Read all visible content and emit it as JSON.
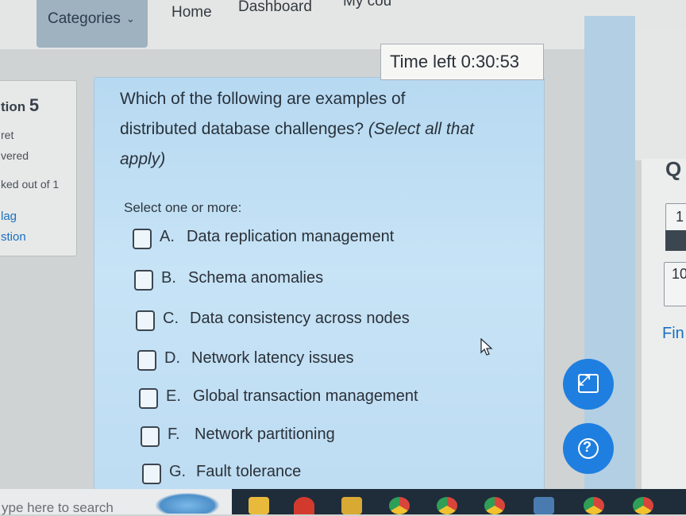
{
  "nav": {
    "categories_label": "Categories",
    "categories_chevron": "⌄",
    "home": "Home",
    "dashboard": "Dashboard",
    "my_courses": "My cou"
  },
  "timer": {
    "label": "Time left 0:30:53"
  },
  "question_info": {
    "number_prefix": "tion",
    "number": "5",
    "status_line1": "ret",
    "status_line2": "vered",
    "marked": "ked out of 1",
    "flag_line1": "lag",
    "flag_line2": "stion"
  },
  "question": {
    "line1": "Which of the following are examples of",
    "line2_plain": "distributed database challenges? ",
    "line2_italic": "(Select all that",
    "line3_italic": "apply)",
    "hint": "Select one or more:"
  },
  "options": [
    {
      "letter": "A.",
      "text": "Data replication management"
    },
    {
      "letter": "B.",
      "text": "Schema anomalies"
    },
    {
      "letter": "C.",
      "text": "Data consistency across nodes"
    },
    {
      "letter": "D.",
      "text": "Network latency issues"
    },
    {
      "letter": "E.",
      "text": "Global transaction management"
    },
    {
      "letter": "F.",
      "text": "Network partitioning"
    },
    {
      "letter": "G.",
      "text": "Fault tolerance"
    }
  ],
  "quiz_nav": {
    "title": "Q",
    "box1": "1",
    "box2": "10",
    "finish": "Fin"
  },
  "taskbar": {
    "search_placeholder": "ype here to search"
  },
  "icons": {
    "expand": "expand-icon",
    "help": "help-icon",
    "cursor": "mouse-cursor-icon"
  },
  "colors": {
    "fab_blue": "#1f7fe0",
    "card_blue": "#bfddf3",
    "link_blue": "#1a6fc0"
  }
}
